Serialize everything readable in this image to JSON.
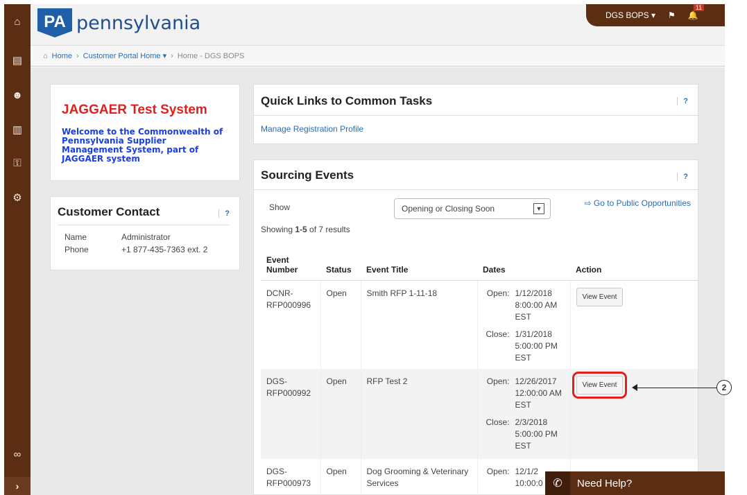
{
  "header": {
    "logo_abbrev": "PA",
    "logo_text": "pennsylvania",
    "user_menu": "DGS BOPS ▾",
    "notification_count": "11"
  },
  "breadcrumb": {
    "home": "Home",
    "customer_portal": "Customer Portal Home ▾",
    "current": "Home - DGS BOPS"
  },
  "welcome": {
    "title": "JAGGAER Test System",
    "message": "Welcome to the Commonwealth of Pennsylvania Supplier Management System, part of JAGGAER system"
  },
  "contact": {
    "title": "Customer Contact",
    "help": "?",
    "name_label": "Name",
    "name_value": "Administrator",
    "phone_label": "Phone",
    "phone_value": "+1 877-435-7363 ext. 2"
  },
  "quick_links": {
    "title": "Quick Links to Common Tasks",
    "help": "?",
    "link": "Manage Registration Profile"
  },
  "events": {
    "title": "Sourcing Events",
    "help": "?",
    "show_label": "Show",
    "filter_value": "Opening or Closing Soon",
    "public_link": "Go to Public Opportunities",
    "count_prefix": "Showing ",
    "count_range": "1-5",
    "count_suffix": " of 7 results",
    "columns": [
      "Event Number",
      "Status",
      "Event Title",
      "Dates",
      "Action"
    ],
    "rows": [
      {
        "number": "DCNR-RFP000996",
        "status": "Open",
        "title": "Smith RFP 1-11-18",
        "open_label": "Open:",
        "open_date": "1/12/2018 8:00:00 AM EST",
        "close_label": "Close:",
        "close_date": "1/31/2018 5:00:00 PM EST",
        "action": "View Event"
      },
      {
        "number": "DGS-RFP000992",
        "status": "Open",
        "title": "RFP Test 2",
        "open_label": "Open:",
        "open_date": "12/26/2017 12:00:00 AM EST",
        "close_label": "Close:",
        "close_date": "2/3/2018 5:00:00 PM EST",
        "action": "View Event"
      },
      {
        "number": "DGS-RFP000973",
        "status": "Open",
        "title": "Dog Grooming & Veterinary Services",
        "open_label": "Open:",
        "open_date": "12/1/2",
        "extra": "10:00:0",
        "action": ""
      }
    ]
  },
  "annotation": {
    "callout": "2"
  },
  "need_help": {
    "label": "Need Help?"
  },
  "colors": {
    "nav_brown": "#5b2d12",
    "title_red": "#e01f1f",
    "link_blue": "#2a6bb5",
    "welcome_blue": "#1a3ee0",
    "pa_blue": "#1f5fa8"
  }
}
